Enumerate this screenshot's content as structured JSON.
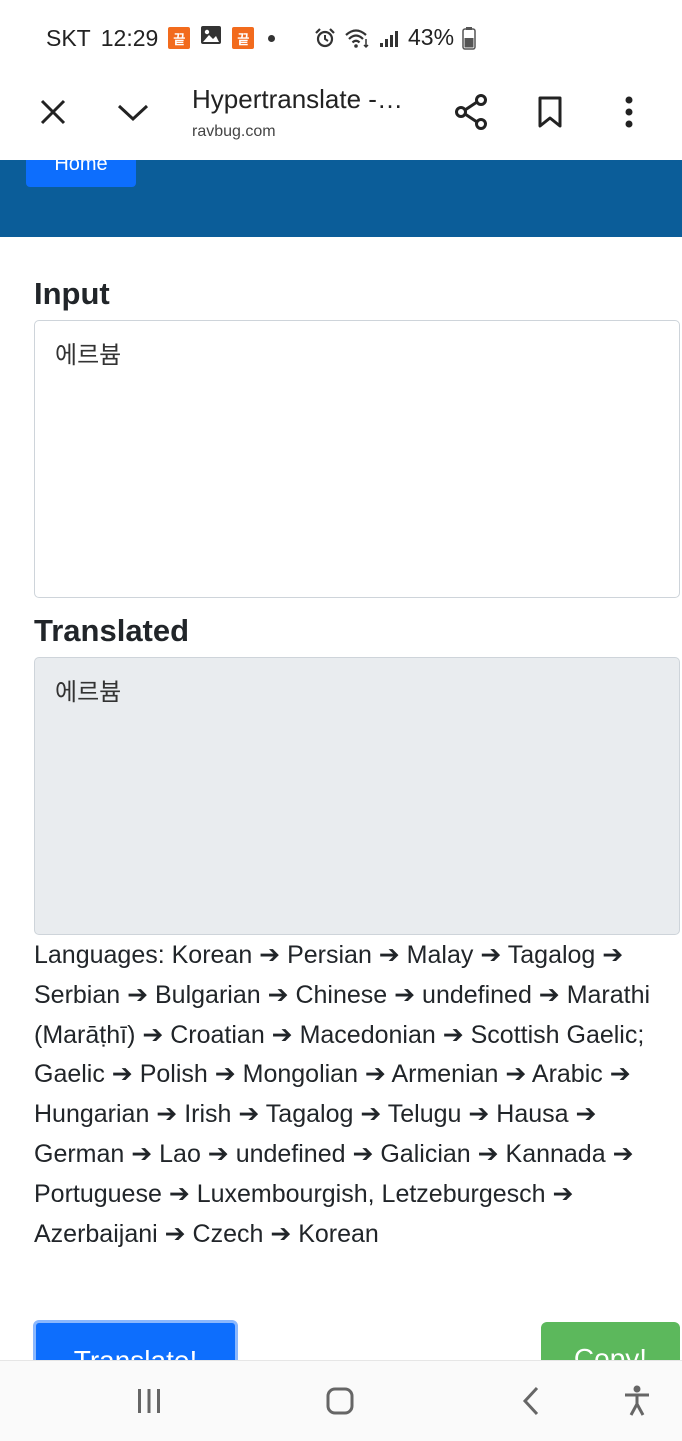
{
  "status_bar": {
    "carrier": "SKT",
    "time": "12:29",
    "badge_a": "끝",
    "badge_b": "끝",
    "battery_percent": "43%"
  },
  "browser": {
    "title": "Hypertranslate -…",
    "url": "ravbug.com"
  },
  "header": {
    "home_label": "Home"
  },
  "form": {
    "input_label": "Input",
    "input_value": "에르븀",
    "translated_label": "Translated",
    "translated_value": "에르븀",
    "languages_text": "Languages: Korean ➔ Persian ➔ Malay ➔ Tagalog ➔ Serbian ➔ Bulgarian ➔ Chinese ➔ undefined ➔ Marathi (Marāṭhī) ➔ Croatian ➔ Macedonian ➔ Scottish Gaelic; Gaelic ➔ Polish ➔ Mongolian ➔ Armenian ➔ Arabic ➔ Hungarian ➔ Irish ➔ Tagalog ➔ Telugu ➔ Hausa ➔ German ➔ Lao ➔ undefined ➔ Galician ➔ Kannada ➔ Portuguese ➔ Luxembourgish, Letzeburgesch ➔ Azerbaijani ➔ Czech ➔ Korean",
    "translate_label": "Translate!",
    "copy_label": "Copy!"
  },
  "colors": {
    "header_blue": "#0b5d99",
    "primary": "#0d6efd",
    "success": "#5cb85c",
    "readonly_bg": "#e9ecef",
    "badge_orange": "#f26b1d"
  },
  "icons": {
    "toolbar": [
      "close-icon",
      "chevron-down-icon",
      "share-icon",
      "bookmark-icon",
      "more-vert-icon"
    ],
    "status": [
      "image-icon",
      "alarm-icon",
      "wifi-icon",
      "signal-icon",
      "battery-icon"
    ],
    "nav": [
      "recents-icon",
      "home-icon",
      "back-icon",
      "accessibility-icon"
    ]
  }
}
